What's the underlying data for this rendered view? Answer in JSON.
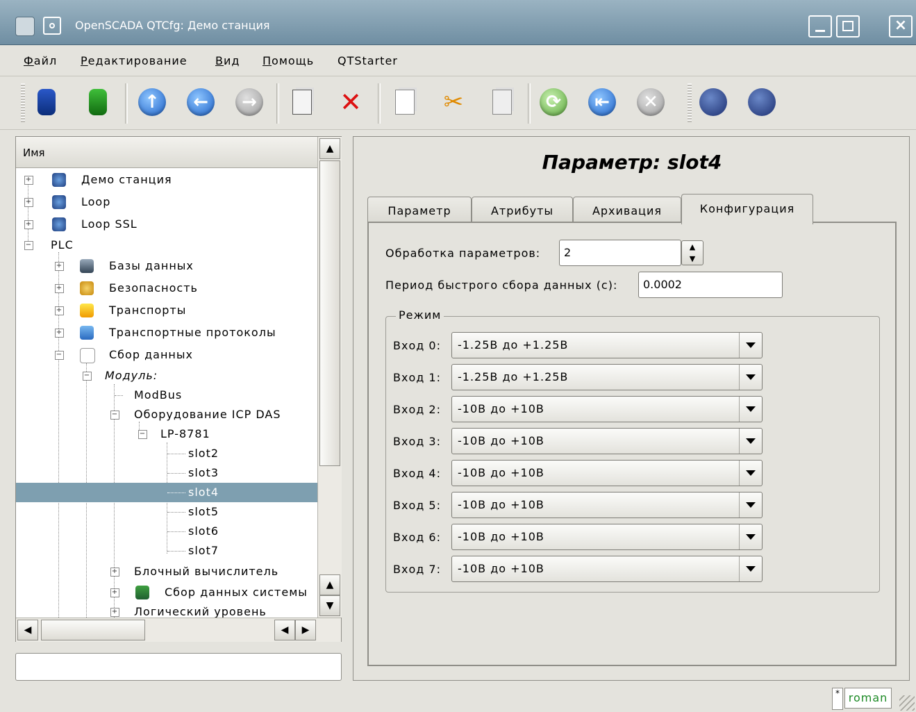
{
  "window": {
    "title": "OpenSCADA QTCfg: Демо станция"
  },
  "menu": [
    {
      "key": "Ф",
      "rest": "айл"
    },
    {
      "key": "Р",
      "rest": "едактирование"
    },
    {
      "key": "В",
      "rest": "ид"
    },
    {
      "key": "П",
      "rest": "омощь"
    },
    {
      "key": "",
      "rest": "QTStarter"
    }
  ],
  "toolbar_icons": [
    "db-load-icon",
    "db-save-icon",
    "up-icon",
    "back-icon",
    "forward-icon",
    "add-item-icon",
    "delete-item-icon",
    "copy-icon",
    "cut-icon",
    "paste-icon",
    "refresh-icon",
    "start-icon",
    "stop-icon",
    "connect-icon",
    "disconnect-icon"
  ],
  "tree": {
    "header": "Имя",
    "items": [
      {
        "label": "Демо станция"
      },
      {
        "label": "Loop"
      },
      {
        "label": "Loop SSL"
      },
      {
        "label": "PLC"
      },
      {
        "label": "Базы данных"
      },
      {
        "label": "Безопасность"
      },
      {
        "label": "Транспорты"
      },
      {
        "label": "Транспортные протоколы"
      },
      {
        "label": "Сбор данных"
      },
      {
        "label": "Модуль:"
      },
      {
        "label": "ModBus"
      },
      {
        "label": "Оборудование ICP DAS"
      },
      {
        "label": "LP-8781"
      },
      {
        "label": "slot2"
      },
      {
        "label": "slot3"
      },
      {
        "label": "slot4"
      },
      {
        "label": "slot5"
      },
      {
        "label": "slot6"
      },
      {
        "label": "slot7"
      },
      {
        "label": "Блочный вычислитель"
      },
      {
        "label": "Сбор данных системы"
      },
      {
        "label": "Логический уровень"
      }
    ],
    "selected": "slot4"
  },
  "page": {
    "title": "Параметр: slot4",
    "tabs": [
      {
        "label": "Параметр"
      },
      {
        "label": "Атрибуты"
      },
      {
        "label": "Архивация"
      },
      {
        "label": "Конфигурация"
      }
    ],
    "active_tab": "Конфигурация",
    "config": {
      "proc_label": "Обработка параметров:",
      "proc_value": "2",
      "period_label": "Период быстрого сбора данных (с):",
      "period_value": "0.0002",
      "mode_label": "Режим",
      "inputs": [
        {
          "label": "Вход 0:",
          "value": "-1.25В до +1.25В"
        },
        {
          "label": "Вход 1:",
          "value": "-1.25В до +1.25В"
        },
        {
          "label": "Вход 2:",
          "value": "-10В до +10В"
        },
        {
          "label": "Вход 3:",
          "value": "-10В до +10В"
        },
        {
          "label": "Вход 4:",
          "value": "-10В до +10В"
        },
        {
          "label": "Вход 5:",
          "value": "-10В до +10В"
        },
        {
          "label": "Вход 6:",
          "value": "-10В до +10В"
        },
        {
          "label": "Вход 7:",
          "value": "-10В до +10В"
        }
      ]
    }
  },
  "statusbar": {
    "kbd": "*",
    "user": "roman"
  },
  "colors": {
    "selection": "#7e9fb0",
    "titlebar": "#6f8ea2",
    "user_text": "#1c8a25"
  }
}
